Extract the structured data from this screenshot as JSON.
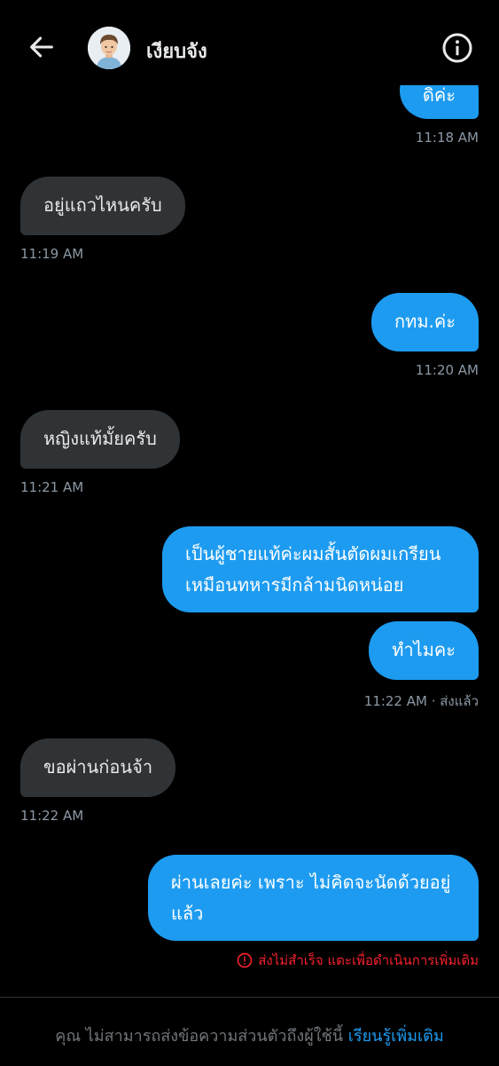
{
  "header": {
    "contact_name": "เงียบจัง"
  },
  "messages": [
    {
      "text": "ดิค่ะ",
      "time": "11:18 AM"
    },
    {
      "text": "อยู่แถวไหนครับ",
      "time": "11:19 AM"
    },
    {
      "text": "กทม.ค่ะ",
      "time": "11:20 AM"
    },
    {
      "text": "หญิงแท้มั้ยครับ",
      "time": "11:21 AM"
    },
    {
      "line1": "เป็นผู้ชายแท้ค่ะผมสั้นตัดผมเกรียน",
      "line2": "เหมือนทหารมีกล้ามนิดหน่อย"
    },
    {
      "text": "ทำไมคะ",
      "time": "11:22 AM · ส่งแล้ว"
    },
    {
      "text": "ขอผ่านก่อนจ้า",
      "time": "11:22 AM"
    },
    {
      "line1": "ผ่านเลยค่ะ เพราะ ไม่คิดจะนัดด้วยอยู่",
      "line2": "แล้ว"
    }
  ],
  "error_text": "ส่งไม่สำเร็จ แตะเพื่อดำเนินการเพิ่มเติม",
  "footer": {
    "text": "คุณ ไม่สามารถส่งข้อความส่วนตัวถึงผู้ใช้นี้",
    "link": "เรียนรู้เพิ่มเติม"
  },
  "colors": {
    "accent": "#1d9bf0",
    "incoming": "#2f3336",
    "error": "#f4212e",
    "background": "#000000"
  }
}
